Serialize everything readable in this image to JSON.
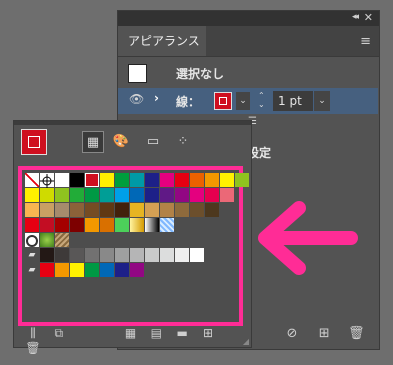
{
  "appearance": {
    "tab_label": "アピアランス",
    "row_none_label": "選択なし",
    "stroke_label": "線：",
    "stroke_weight": "1 pt",
    "defaults_label": "初期設定",
    "collapse_glyph": "◂◂",
    "close_glyph": "✕",
    "menu_glyph": "≡"
  },
  "swatches": {
    "rows": [
      {
        "type": "colors",
        "colors": [
          "none",
          "registration",
          "#ffffff",
          "#000000",
          "#cf0f1f",
          "#ffef00",
          "#009e3d",
          "#009aa6",
          "#1d2088",
          "#e4007f",
          "#e60012",
          "#eb6100",
          "#f39800",
          "#fff100",
          "#8fc31f"
        ]
      },
      {
        "type": "colors",
        "colors": [
          "#fff100",
          "#cfdb00",
          "#8fc31f",
          "#22ac38",
          "#009944",
          "#009e96",
          "#00a0e9",
          "#0068b7",
          "#1d2088",
          "#601986",
          "#920783",
          "#e4007f",
          "#e5004f",
          "#eb6877"
        ]
      },
      {
        "type": "colors",
        "colors": [
          "#f8b551",
          "#c9a063",
          "#a68b6d",
          "#8c6239",
          "#754c24",
          "#603813",
          "#42210b",
          "#e6b422",
          "#d4a054",
          "#b28247",
          "#8e6a3c",
          "#6c4f2c",
          "#4d381e"
        ]
      },
      {
        "type": "colors",
        "colors": [
          "#e60012",
          "#c30d23",
          "#a40000",
          "#7d0000",
          "#f39800",
          "#d97000",
          "#4cd05a",
          "gradient-gold",
          "gradient-black",
          "gradient-blue"
        ]
      },
      {
        "type": "patterns",
        "colors": [
          "pattern-circle",
          "pattern-leaf",
          "pattern-texture"
        ]
      },
      {
        "type": "folder",
        "colors": [
          "#231815",
          "#3e3a39",
          "#595757",
          "#727171",
          "#898989",
          "#9fa0a0",
          "#b5b5b6",
          "#c9caca",
          "#dcdddd",
          "#efefef",
          "#ffffff"
        ]
      },
      {
        "type": "folder",
        "colors": [
          "#e60012",
          "#f39800",
          "#fff100",
          "#009944",
          "#0068b7",
          "#1d2088",
          "#920783"
        ]
      }
    ]
  }
}
